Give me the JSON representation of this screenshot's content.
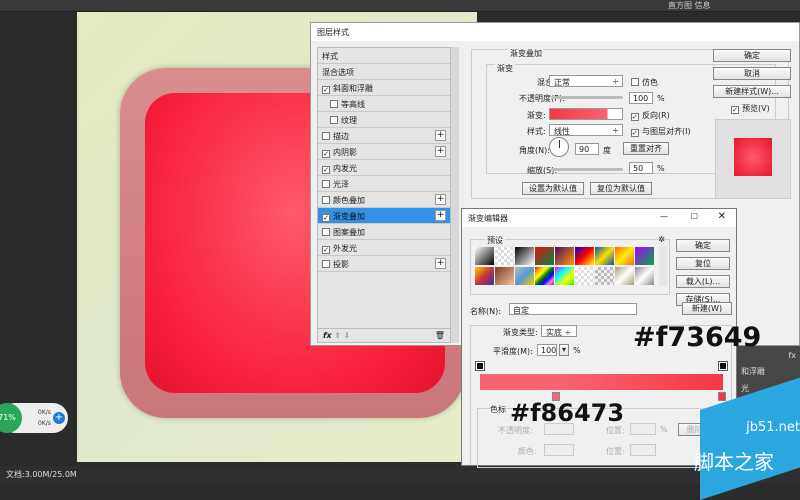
{
  "app": {
    "status": "文档:3.00M/25.0M",
    "histogram_tab": "直方图",
    "info_tab": "信息"
  },
  "widget": {
    "percent": "71%",
    "up": "0K/s",
    "down": "0K/s",
    "plus": "+"
  },
  "right_panel": {
    "items": [
      "fx",
      "和浮雕",
      "",
      "光"
    ]
  },
  "layer_style": {
    "title": "图层样式",
    "list": [
      {
        "label": "样式",
        "checkbox": null,
        "plus": false
      },
      {
        "label": "混合选项",
        "checkbox": null,
        "plus": false
      },
      {
        "label": "斜面和浮雕",
        "checkbox": true,
        "plus": false
      },
      {
        "label": "等高线",
        "checkbox": false,
        "plus": false,
        "indent": true
      },
      {
        "label": "纹理",
        "checkbox": false,
        "plus": false,
        "indent": true
      },
      {
        "label": "描边",
        "checkbox": false,
        "plus": true
      },
      {
        "label": "内阴影",
        "checkbox": true,
        "plus": true
      },
      {
        "label": "内发光",
        "checkbox": true,
        "plus": false
      },
      {
        "label": "光泽",
        "checkbox": false,
        "plus": false
      },
      {
        "label": "颜色叠加",
        "checkbox": false,
        "plus": true
      },
      {
        "label": "渐变叠加",
        "checkbox": true,
        "plus": true,
        "active": true
      },
      {
        "label": "图案叠加",
        "checkbox": false,
        "plus": false
      },
      {
        "label": "外发光",
        "checkbox": true,
        "plus": false
      },
      {
        "label": "投影",
        "checkbox": false,
        "plus": true
      }
    ],
    "fx": "fx",
    "section": "渐变叠加",
    "group": "渐变",
    "blend_mode_label": "混合模式:",
    "blend_mode": "正常",
    "dither": "仿色",
    "opacity_label": "不透明度(P):",
    "opacity": "100",
    "opacity_value": 100,
    "pct": "%",
    "gradient_label": "渐变:",
    "reverse": "反向(R)",
    "style_label": "样式:",
    "style": "线性",
    "align": "与图层对齐(I)",
    "angle_label": "角度(N):",
    "angle": "90",
    "deg": "度",
    "reset_align": "重置对齐",
    "scale_label": "缩放(S):",
    "scale": "50",
    "scale_value": 50,
    "set_default": "设置为默认值",
    "reset_default": "复位为默认值",
    "ok": "确定",
    "cancel": "取消",
    "new_style": "新建样式(W)...",
    "preview": "预览(V)"
  },
  "gradient_editor": {
    "title": "渐变编辑器",
    "presets": "预设",
    "ok": "确定",
    "reset": "复位",
    "load": "载入(L)...",
    "save": "存储(S)...",
    "new": "新建(W)",
    "name_label": "名称(N):",
    "name": "自定",
    "type_label": "渐变类型:",
    "type": "实底",
    "smooth_label": "平滑度(M):",
    "smooth": "100",
    "pct": "%",
    "stops": "色标",
    "opacity_label": "不透明度:",
    "location_label": "位置:",
    "delete": "删除(D)",
    "color_label": "颜色:",
    "location_label2": "位置:",
    "colors": {
      "start": "#f86473",
      "end": "#f73649"
    },
    "swatches": [
      "linear-gradient(135deg,#fff,#000)",
      "repeating-conic-gradient(#ddd 0 25%,#fff 0 50%) 0 0/6px 6px",
      "linear-gradient(135deg,#000,#fff)",
      "linear-gradient(135deg,#d11,#084)",
      "linear-gradient(135deg,#4a0c6b,#f90)",
      "linear-gradient(135deg,#00c,#f00,#ff0)",
      "linear-gradient(135deg,#05a,#fd0,#05a)",
      "linear-gradient(135deg,#f60,#fe0,#f60)",
      "linear-gradient(135deg,#a0f,#0a4)",
      "linear-gradient(135deg,#fc0,#c33,#33a)",
      "linear-gradient(135deg,#7a3b22,#f2c2a0)",
      "linear-gradient(135deg,#bbb,#59c,#fc0)",
      "linear-gradient(135deg,red,orange,yellow,green,blue,violet,red)",
      "linear-gradient(135deg,#f0f,#0ff,#ff0,#0f0)",
      "repeating-conic-gradient(#ddd 0 25%,#fff 0 50%) 0 0/6px 6px",
      "repeating-conic-gradient(#bbb 0 25%,#eee 0 50%) 0 0/6px 6px",
      "linear-gradient(135deg,#a97,#fff,#a97)",
      "linear-gradient(135deg,#888,#fff,#888)"
    ]
  },
  "annotations": {
    "end_hex": "#f73649",
    "start_hex": "#f86473"
  },
  "watermark": {
    "url": "jb51.net",
    "name": "脚本之家"
  }
}
